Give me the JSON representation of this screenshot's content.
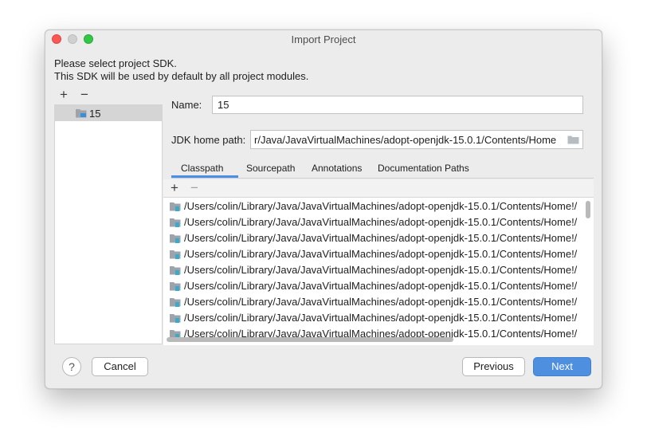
{
  "window": {
    "title": "Import Project"
  },
  "instructions": {
    "line1": "Please select project SDK.",
    "line2": "This SDK will be used by default by all project modules."
  },
  "sdk_toolbar": {
    "add": "+",
    "remove": "−"
  },
  "sdk_list": {
    "items": [
      {
        "label": "15",
        "icon": "sdk-folder-icon",
        "selected": true
      }
    ]
  },
  "fields": {
    "name_label": "Name:",
    "name_value": "15",
    "jdk_label": "JDK home path:",
    "jdk_value": "r/Java/JavaVirtualMachines/adopt-openjdk-15.0.1/Contents/Home"
  },
  "tabs": [
    {
      "label": "Classpath",
      "active": true
    },
    {
      "label": "Sourcepath",
      "active": false
    },
    {
      "label": "Annotations",
      "active": false
    },
    {
      "label": "Documentation Paths",
      "active": false
    }
  ],
  "classpath": {
    "toolbar": {
      "add": "+",
      "remove": "−"
    },
    "rows": [
      "/Users/colin/Library/Java/JavaVirtualMachines/adopt-openjdk-15.0.1/Contents/Home!/",
      "/Users/colin/Library/Java/JavaVirtualMachines/adopt-openjdk-15.0.1/Contents/Home!/",
      "/Users/colin/Library/Java/JavaVirtualMachines/adopt-openjdk-15.0.1/Contents/Home!/",
      "/Users/colin/Library/Java/JavaVirtualMachines/adopt-openjdk-15.0.1/Contents/Home!/",
      "/Users/colin/Library/Java/JavaVirtualMachines/adopt-openjdk-15.0.1/Contents/Home!/",
      "/Users/colin/Library/Java/JavaVirtualMachines/adopt-openjdk-15.0.1/Contents/Home!/",
      "/Users/colin/Library/Java/JavaVirtualMachines/adopt-openjdk-15.0.1/Contents/Home!/",
      "/Users/colin/Library/Java/JavaVirtualMachines/adopt-openjdk-15.0.1/Contents/Home!/",
      "/Users/colin/Library/Java/JavaVirtualMachines/adopt-openjdk-15.0.1/Contents/Home!/"
    ]
  },
  "buttons": {
    "help": "?",
    "cancel": "Cancel",
    "previous": "Previous",
    "next": "Next"
  },
  "colors": {
    "accent": "#4e8fe0",
    "close": "#fc5753",
    "maximize": "#33c748",
    "selection": "#d5d5d5"
  }
}
